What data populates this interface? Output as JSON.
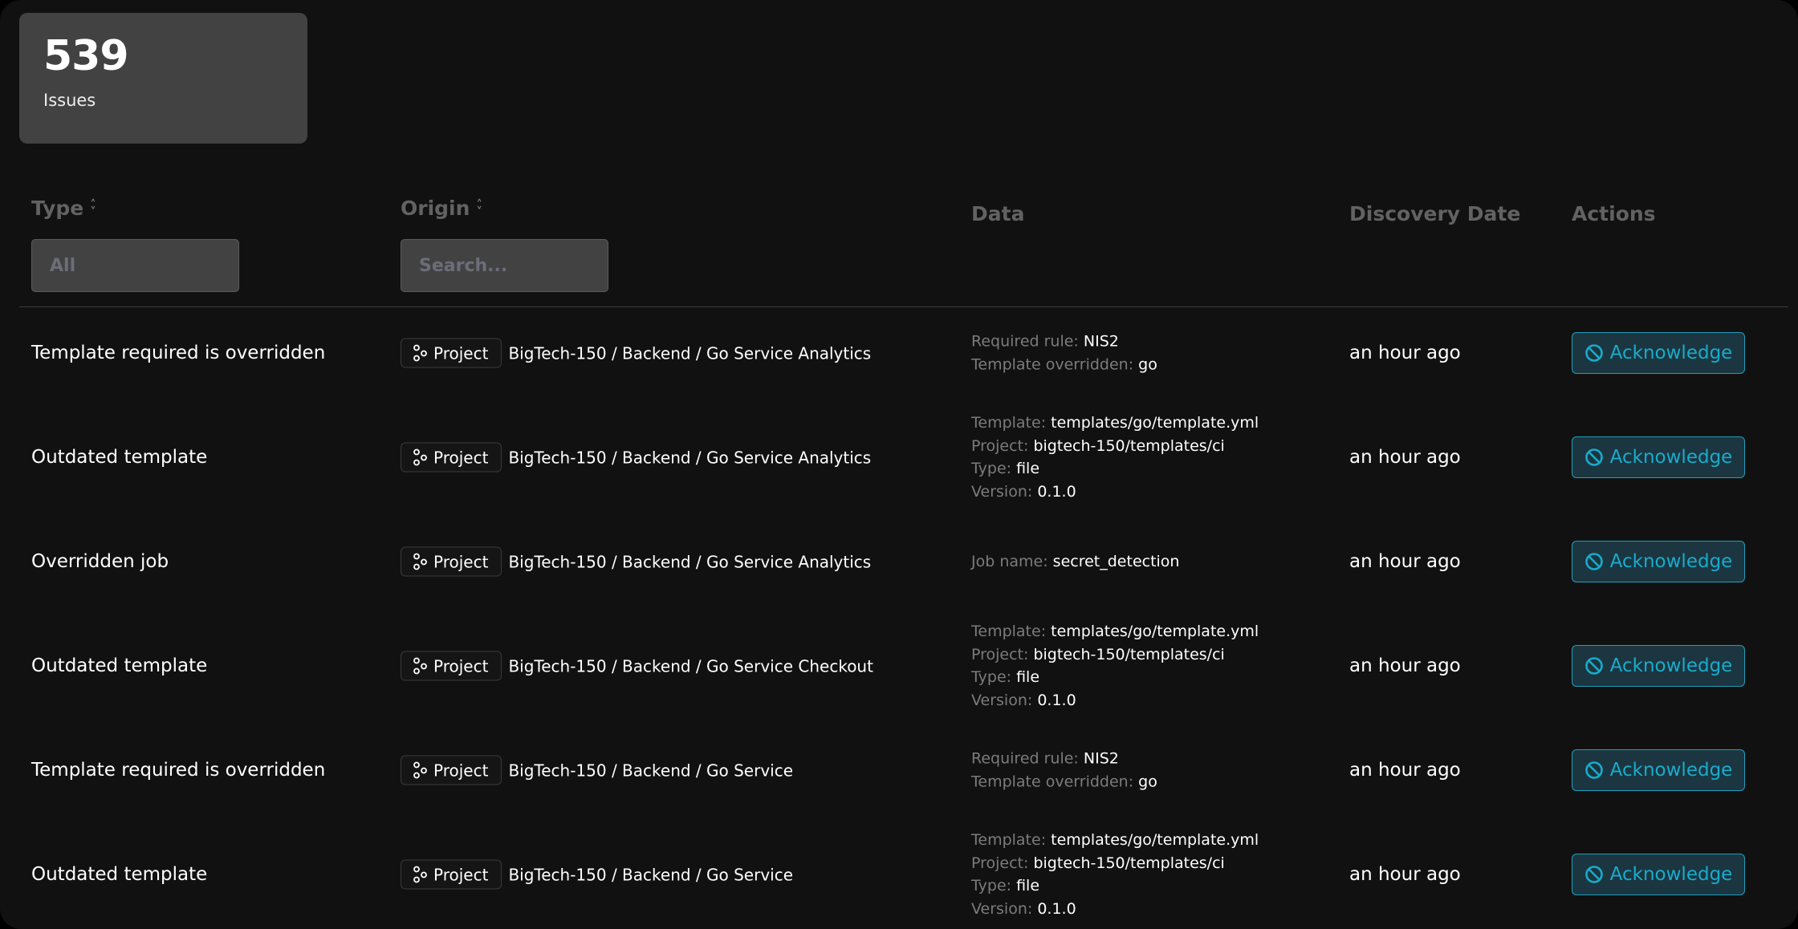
{
  "stat": {
    "value": "539",
    "label": "Issues"
  },
  "headers": {
    "type": "Type",
    "origin": "Origin",
    "data": "Data",
    "date": "Discovery Date",
    "actions": "Actions"
  },
  "filters": {
    "type_value": "All",
    "origin_placeholder": "Search..."
  },
  "colors": {
    "accent": "#19abcc",
    "background": "#111112",
    "card": "#424242"
  },
  "rows": [
    {
      "type": "Template required is overridden",
      "origin_kind": "Project",
      "origin_path": "BigTech-150 / Backend / Go Service Analytics",
      "data": [
        {
          "k": "Required rule:",
          "v": "NIS2"
        },
        {
          "k": "Template overridden:",
          "v": "go"
        }
      ],
      "date": "an hour ago",
      "action": "Acknowledge"
    },
    {
      "type": "Outdated template",
      "origin_kind": "Project",
      "origin_path": "BigTech-150 / Backend / Go Service Analytics",
      "data": [
        {
          "k": "Template:",
          "v": "templates/go/template.yml"
        },
        {
          "k": "Project:",
          "v": "bigtech-150/templates/ci"
        },
        {
          "k": "Type:",
          "v": "file"
        },
        {
          "k": "Version:",
          "v": "0.1.0"
        }
      ],
      "date": "an hour ago",
      "action": "Acknowledge"
    },
    {
      "type": "Overridden job",
      "origin_kind": "Project",
      "origin_path": "BigTech-150 / Backend / Go Service Analytics",
      "data": [
        {
          "k": "Job name:",
          "v": "secret_detection"
        }
      ],
      "date": "an hour ago",
      "action": "Acknowledge"
    },
    {
      "type": "Outdated template",
      "origin_kind": "Project",
      "origin_path": "BigTech-150 / Backend / Go Service Checkout",
      "data": [
        {
          "k": "Template:",
          "v": "templates/go/template.yml"
        },
        {
          "k": "Project:",
          "v": "bigtech-150/templates/ci"
        },
        {
          "k": "Type:",
          "v": "file"
        },
        {
          "k": "Version:",
          "v": "0.1.0"
        }
      ],
      "date": "an hour ago",
      "action": "Acknowledge"
    },
    {
      "type": "Template required is overridden",
      "origin_kind": "Project",
      "origin_path": "BigTech-150 / Backend / Go Service",
      "data": [
        {
          "k": "Required rule:",
          "v": "NIS2"
        },
        {
          "k": "Template overridden:",
          "v": "go"
        }
      ],
      "date": "an hour ago",
      "action": "Acknowledge"
    },
    {
      "type": "Outdated template",
      "origin_kind": "Project",
      "origin_path": "BigTech-150 / Backend / Go Service",
      "data": [
        {
          "k": "Template:",
          "v": "templates/go/template.yml"
        },
        {
          "k": "Project:",
          "v": "bigtech-150/templates/ci"
        },
        {
          "k": "Type:",
          "v": "file"
        },
        {
          "k": "Version:",
          "v": "0.1.0"
        }
      ],
      "date": "an hour ago",
      "action": "Acknowledge"
    }
  ]
}
